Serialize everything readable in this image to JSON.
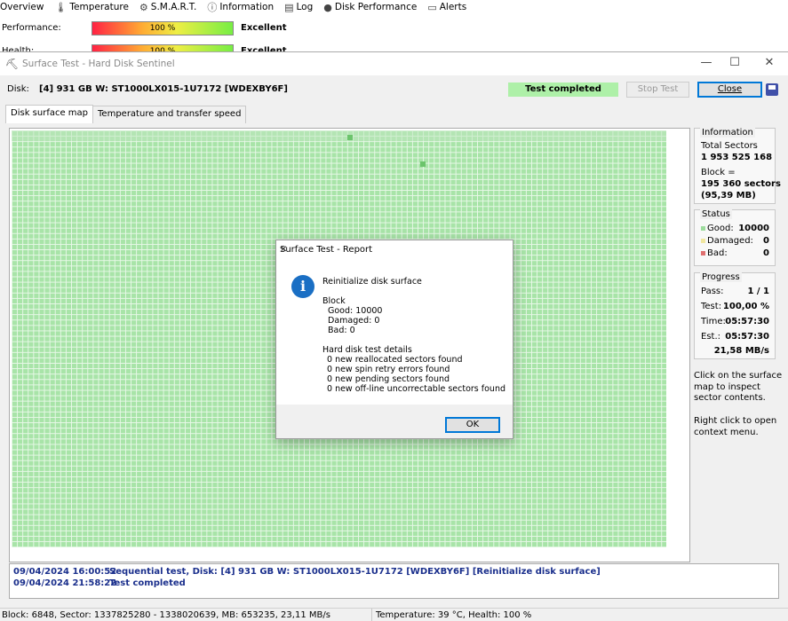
{
  "background_app": {
    "menu": [
      {
        "label": "Overview",
        "icon": "none"
      },
      {
        "label": "Temperature",
        "icon": "thermometer-icon"
      },
      {
        "label": "S.M.A.R.T.",
        "icon": "smart-icon"
      },
      {
        "label": "Information",
        "icon": "info-icon"
      },
      {
        "label": "Log",
        "icon": "log-icon"
      },
      {
        "label": "Disk Performance",
        "icon": "performance-icon"
      },
      {
        "label": "Alerts",
        "icon": "alerts-icon"
      }
    ],
    "rows": [
      {
        "label": "Performance:",
        "bar_text": "100 %",
        "value": "Excellent"
      },
      {
        "label": "Health:",
        "bar_text": "100 %",
        "value": "Excellent"
      }
    ]
  },
  "window": {
    "title": "Surface Test - Hard Disk Sentinel",
    "disk_label": "Disk:",
    "disk_name": "[4] 931 GB W: ST1000LX015-1U7172 [WDEXBY6F]",
    "status": "Test completed",
    "stop_button": "Stop Test",
    "close_button": "Close",
    "tabs": [
      "Disk surface map",
      "Temperature and transfer speed"
    ]
  },
  "information": {
    "header": "Information",
    "total_sectors_label": "Total Sectors",
    "total_sectors_value": "1 953 525 168",
    "block_label": "Block =",
    "block_value": "195 360 sectors",
    "block_size": "(95,39 MB)"
  },
  "status_panel": {
    "header": "Status",
    "good_label": "Good:",
    "good_value": "10000",
    "damaged_label": "Damaged:",
    "damaged_value": "0",
    "bad_label": "Bad:",
    "bad_value": "0"
  },
  "progress": {
    "header": "Progress",
    "pass_label": "Pass:",
    "pass_value": "1 / 1",
    "test_label": "Test:",
    "test_value": "100,00 %",
    "time_label": "Time:",
    "time_value": "05:57:30",
    "est_label": "Est.:",
    "est_value": "05:57:30",
    "speed": "21,58 MB/s"
  },
  "notes": {
    "click": "Click on the surface map to inspect sector contents.",
    "right_click": "Right click to open context menu."
  },
  "log": [
    {
      "time": "09/04/2024  16:00:52",
      "text": "Sequential test, Disk: [4] 931 GB W: ST1000LX015-1U7172 [WDEXBY6F] [Reinitialize disk surface]"
    },
    {
      "time": "09/04/2024  21:58:22",
      "text": "Test completed"
    }
  ],
  "statusbar": {
    "left": "Block: 6848, Sector: 1337825280 - 1338020639, MB: 653235, 23,11 MB/s",
    "right": "Temperature: 39  °C, Health: 100 %"
  },
  "dialog": {
    "title": "Surface Test - Report",
    "heading": "Reinitialize disk surface",
    "block_header": "Block",
    "good": "Good: 10000",
    "damaged": "Damaged: 0",
    "bad": "Bad: 0",
    "details_header": "Hard disk test details",
    "details": [
      "0 new reallocated sectors found",
      "0 new spin retry errors found",
      "0 new pending sectors found",
      "0 new off-line uncorrectable sectors found"
    ],
    "ok": "OK"
  },
  "colors": {
    "good_block": "#a8e4a8",
    "status_completed": "#aef0a8",
    "log_text": "#1a2f8c",
    "info_icon": "#1a6fc4"
  }
}
